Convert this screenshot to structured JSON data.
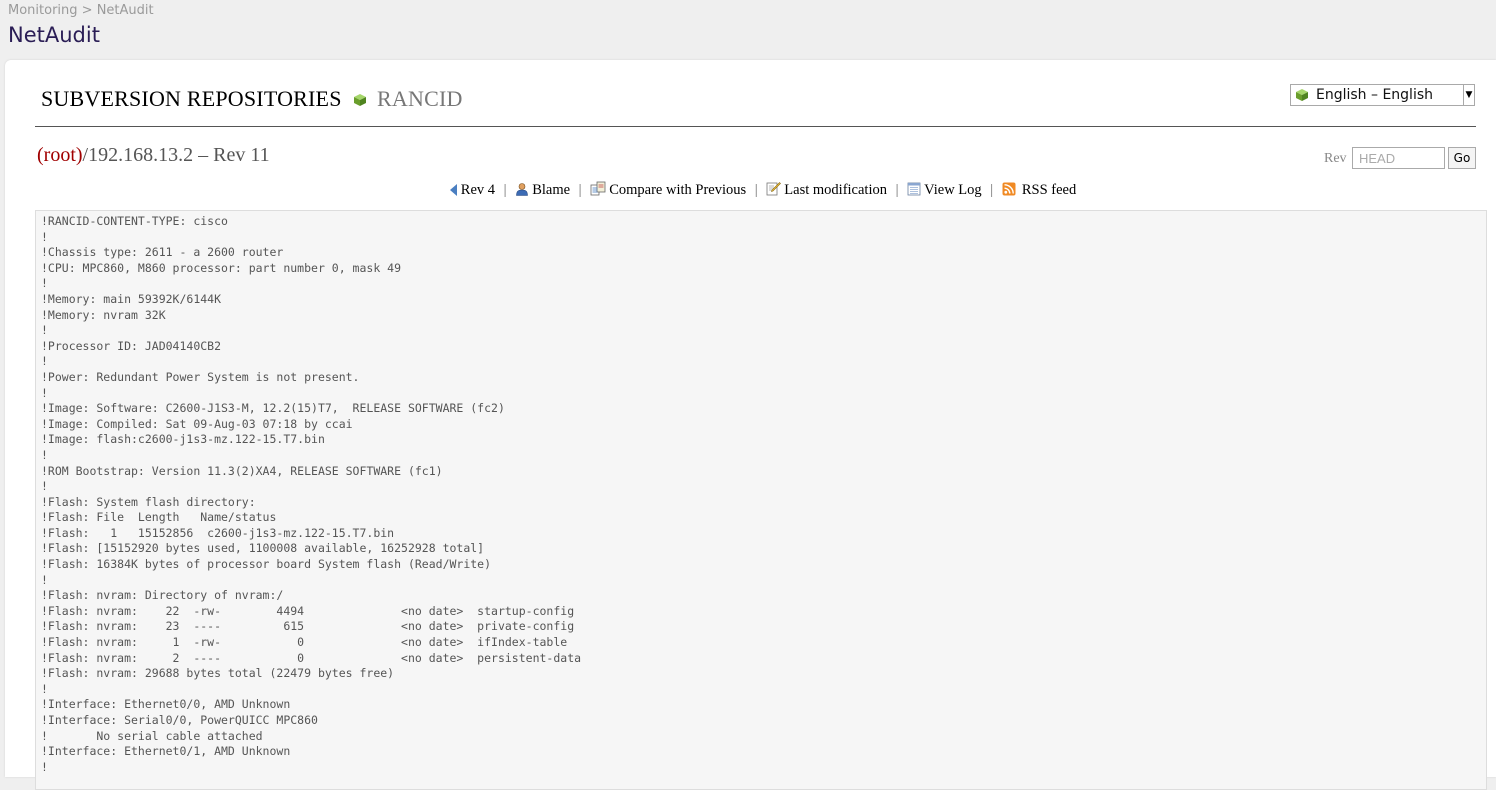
{
  "breadcrumb": {
    "parent": "Monitoring",
    "separator": " > ",
    "current": "NetAudit"
  },
  "app": {
    "title": "NetAudit"
  },
  "repository": {
    "heading": "SUBVERSION REPOSITORIES",
    "name": "RANCID"
  },
  "language": {
    "selected": "English – English"
  },
  "path": {
    "root_label": "(root)",
    "rest": "/192.168.13.2 – Rev 11"
  },
  "rev_form": {
    "label": "Rev",
    "placeholder": "HEAD",
    "go_label": "Go"
  },
  "actions": {
    "prev_rev": "Rev 4",
    "blame": "Blame",
    "compare": "Compare with Previous",
    "last_mod": "Last modification",
    "view_log": "View Log",
    "rss": "RSS feed",
    "separator": "|"
  },
  "file_content": "!RANCID-CONTENT-TYPE: cisco\n!\n!Chassis type: 2611 - a 2600 router\n!CPU: MPC860, M860 processor: part number 0, mask 49\n!\n!Memory: main 59392K/6144K\n!Memory: nvram 32K\n!\n!Processor ID: JAD04140CB2\n!\n!Power: Redundant Power System is not present.\n!\n!Image: Software: C2600-J1S3-M, 12.2(15)T7,  RELEASE SOFTWARE (fc2)\n!Image: Compiled: Sat 09-Aug-03 07:18 by ccai\n!Image: flash:c2600-j1s3-mz.122-15.T7.bin\n!\n!ROM Bootstrap: Version 11.3(2)XA4, RELEASE SOFTWARE (fc1)\n!\n!Flash: System flash directory:\n!Flash: File  Length   Name/status\n!Flash:   1   15152856  c2600-j1s3-mz.122-15.T7.bin\n!Flash: [15152920 bytes used, 1100008 available, 16252928 total]\n!Flash: 16384K bytes of processor board System flash (Read/Write)\n!\n!Flash: nvram: Directory of nvram:/\n!Flash: nvram:    22  -rw-        4494              <no date>  startup-config\n!Flash: nvram:    23  ----         615              <no date>  private-config\n!Flash: nvram:     1  -rw-           0              <no date>  ifIndex-table\n!Flash: nvram:     2  ----           0              <no date>  persistent-data\n!Flash: nvram: 29688 bytes total (22479 bytes free)\n!\n!Interface: Ethernet0/0, AMD Unknown\n!Interface: Serial0/0, PowerQUICC MPC860\n!       No serial cable attached\n!Interface: Ethernet0/1, AMD Unknown\n!",
  "colors": {
    "title": "#2a1d55",
    "root_link": "#a00000",
    "code_background": "#f6f6f6",
    "repo_icon": "#7cb342"
  },
  "icons": {
    "repo": "green-cube-icon",
    "language": "green-cube-icon",
    "prev_rev": "left-arrow-icon",
    "blame": "user-icon",
    "compare": "compare-icon",
    "last_mod": "edit-icon",
    "view_log": "log-icon",
    "rss": "rss-icon"
  }
}
